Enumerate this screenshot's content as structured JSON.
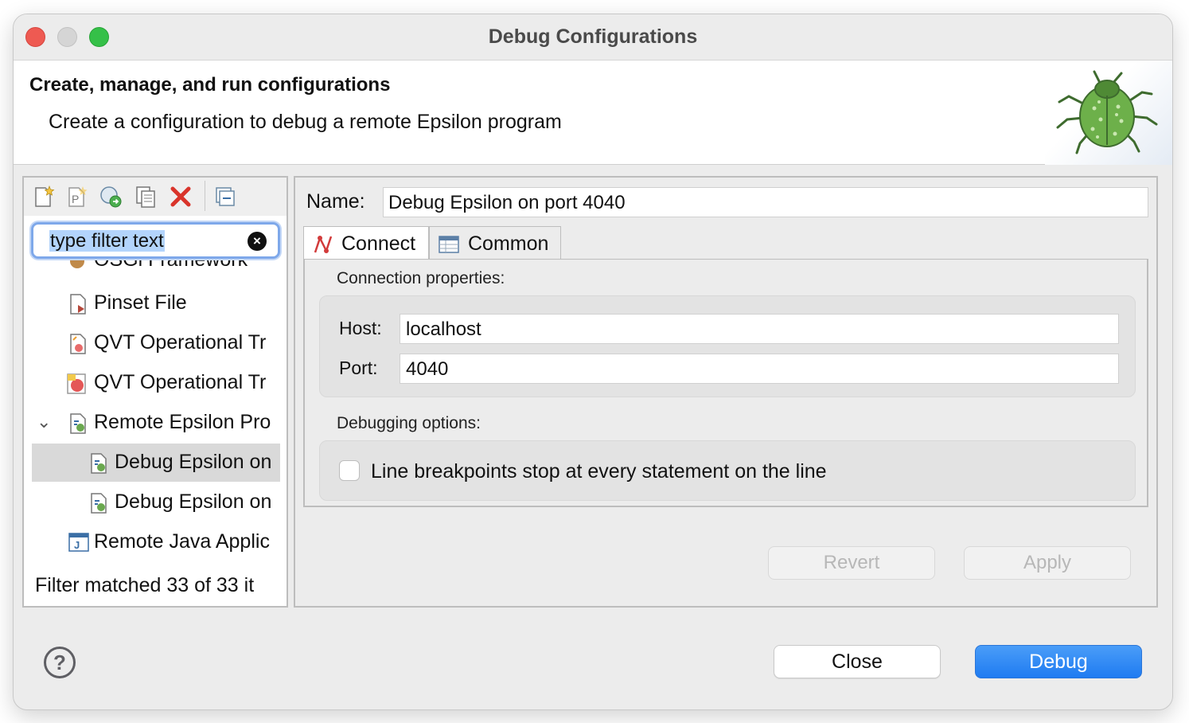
{
  "window": {
    "title": "Debug Configurations"
  },
  "header": {
    "title": "Create, manage, and run configurations",
    "message": "Create a configuration to debug a remote Epsilon program",
    "icon": "bug-icon"
  },
  "left_pane": {
    "toolbar": [
      "new-configuration-icon",
      "new-prototype-icon",
      "export-icon",
      "duplicate-icon",
      "delete-icon",
      "collapse-all-icon"
    ],
    "filter": {
      "placeholder": "type filter text"
    },
    "tree": [
      {
        "label": "OSGi Framework",
        "icon": "osgi-icon"
      },
      {
        "label": "Pinset File",
        "icon": "file-icon"
      },
      {
        "label": "QVT Operational Tr",
        "icon": "qvt-icon"
      },
      {
        "label": "QVT Operational Tr",
        "icon": "qvt-icon"
      },
      {
        "label": "Remote Epsilon Pro",
        "icon": "epsilon-icon",
        "expanded": true
      },
      {
        "label": "Debug Epsilon on",
        "icon": "epsilon-icon",
        "selected": true
      },
      {
        "label": "Debug Epsilon on",
        "icon": "epsilon-icon"
      },
      {
        "label": "Remote Java Applic",
        "icon": "java-icon"
      }
    ],
    "status": "Filter matched 33 of 33 it"
  },
  "right_pane": {
    "name_label": "Name:",
    "name_value": "Debug Epsilon on port 4040",
    "tabs": [
      {
        "label": "Connect",
        "active": true,
        "icon": "connect-icon"
      },
      {
        "label": "Common",
        "active": false,
        "icon": "common-icon"
      }
    ],
    "connection": {
      "section": "Connection properties:",
      "host_label": "Host:",
      "host_value": "localhost",
      "port_label": "Port:",
      "port_value": "4040"
    },
    "debugging": {
      "section": "Debugging options:",
      "checkbox_label": "Line breakpoints stop at every statement on the line",
      "checked": false
    },
    "revert_label": "Revert",
    "apply_label": "Apply"
  },
  "footer": {
    "help_label": "?",
    "close_label": "Close",
    "debug_label": "Debug"
  }
}
